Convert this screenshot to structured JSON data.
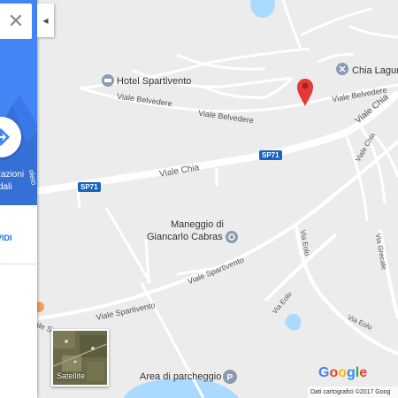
{
  "map": {
    "pois": {
      "hotel": "Hotel Spartivento",
      "chia": "Chia Lagun",
      "maneggio_line1": "Maneggio di",
      "maneggio_line2": "Giancarlo Cabras",
      "parking": "Area di parcheggio"
    },
    "roads": {
      "viale_belvedere_a": "Viale Belvedere",
      "viale_belvedere_b": "Viale Belvedere",
      "viale_belvedere_c": "Viale Belvedere",
      "viale_chia_main": "Viale Chia",
      "viale_chia_ne": "Viale Chia",
      "viale_chia_ne2": "Viale Chia",
      "sp71_a": "SP71",
      "sp71_b": "SP71",
      "viale_spartivento_a": "Viale Spartivento",
      "viale_spartivento_b": "Viale Spartivento",
      "viale_spartivento_c": "Viale Spartivento",
      "via_eolo_a": "Via Eolo",
      "via_eolo_b": "Via Eolo",
      "via_eolo_c": "Via Eolo",
      "via_grecale": "Via Grecale"
    },
    "colors": {
      "background": "#ececec",
      "roads": "#ffffff",
      "water": "#aadaff",
      "pin": "#e53935",
      "poi_icon": "#8a9bb0",
      "highway_shield": "#1565c0"
    }
  },
  "panel": {
    "close_symbol": "✕",
    "collapse_symbol": "◀",
    "header_line1": "zazioni",
    "header_line2": "dali",
    "side_text": "oleto",
    "save_text": "VIDI",
    "accent": "#4285f4"
  },
  "controls": {
    "satellite_label": "Satellite"
  },
  "footer": {
    "google_logo": "Google",
    "attribution": "Dati cartografici ©2017 Goog"
  }
}
